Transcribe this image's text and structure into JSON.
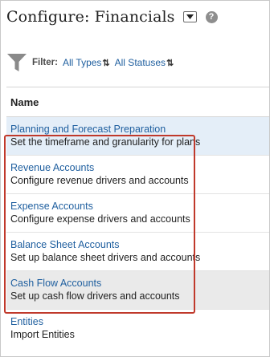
{
  "header": {
    "title": "Configure: Financials",
    "menu_icon": "triangle-down-icon",
    "help_icon": "question-icon",
    "help_glyph": "?"
  },
  "filter": {
    "label": "Filter:",
    "types": "All Types",
    "statuses": "All Statuses",
    "sort_glyph": "⇅"
  },
  "table": {
    "column_name": "Name",
    "rows": [
      {
        "title": "Planning and Forecast Preparation",
        "description": "Set the timeframe and granularity for plans"
      },
      {
        "title": "Revenue Accounts",
        "description": "Configure revenue drivers and accounts"
      },
      {
        "title": "Expense Accounts",
        "description": "Configure expense drivers and accounts"
      },
      {
        "title": "Balance Sheet Accounts",
        "description": "Set up balance sheet drivers and accounts"
      },
      {
        "title": "Cash Flow Accounts",
        "description": "Set up cash flow drivers and accounts"
      },
      {
        "title": "Entities",
        "description": "Import Entities"
      }
    ]
  },
  "colors": {
    "link": "#1f5f9f",
    "selected_row": "#e4eef8",
    "hover_row": "#eaeaea",
    "highlight": "#c0392b"
  }
}
